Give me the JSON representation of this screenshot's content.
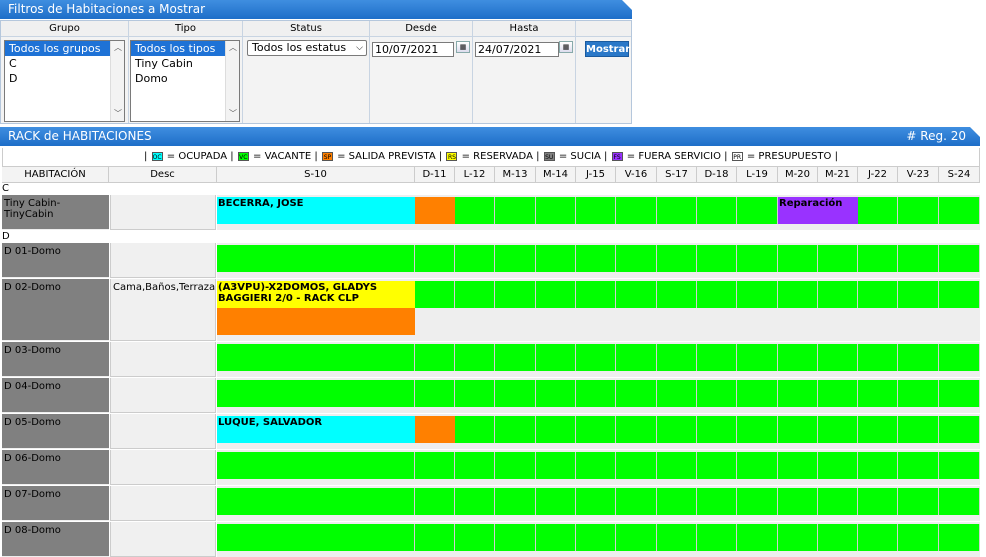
{
  "filters": {
    "title": "Filtros de Habitaciones a Mostrar",
    "labels": {
      "grupo": "Grupo",
      "tipo": "Tipo",
      "status": "Status",
      "desde": "Desde",
      "hasta": "Hasta"
    },
    "grupo_options": [
      "Todos los grupos",
      "C",
      "D"
    ],
    "tipo_options": [
      "Todos los tipos",
      "Tiny Cabin",
      "Domo"
    ],
    "status_value": "Todos los estatus",
    "desde": "10/07/2021",
    "hasta": "24/07/2021",
    "mostrar": "Mostrar"
  },
  "rack": {
    "title": "RACK de HABITACIONES",
    "reg": "# Reg. 20",
    "legend": {
      "ocupada": {
        "code": "OC",
        "label": "= OCUPADA",
        "color": "#00ffff"
      },
      "vacante": {
        "code": "VC",
        "label": "= VACANTE",
        "color": "#00ff00"
      },
      "salida": {
        "code": "SP",
        "label": "= SALIDA PREVISTA",
        "color": "#ff8000"
      },
      "reservada": {
        "code": "RS",
        "label": "= RESERVADA",
        "color": "#ffff00"
      },
      "sucia": {
        "code": "SU",
        "label": "= SUCIA",
        "color": "#808080"
      },
      "fuera": {
        "code": "FS",
        "label": "= FUERA SERVICIO",
        "color": "#9932ff"
      },
      "presupuesto": {
        "code": "PR",
        "label": "= PRESUPUESTO",
        "color": "#ffffff"
      }
    },
    "headers": {
      "habitacion": "HABITACIÓN",
      "desc": "Desc"
    },
    "days": [
      "S-10",
      "D-11",
      "L-12",
      "M-13",
      "M-14",
      "J-15",
      "V-16",
      "S-17",
      "D-18",
      "L-19",
      "M-20",
      "M-21",
      "J-22",
      "V-23",
      "S-24"
    ],
    "groups": [
      {
        "name": "C",
        "rooms": [
          {
            "name": "Tiny Cabin-TinyCabin",
            "desc": "",
            "bars": [
              {
                "text": "BECERRA, JOSE",
                "color": "#00ffff",
                "start": 0,
                "end": 1
              },
              {
                "text": "",
                "color": "#ff8000",
                "start": 1,
                "end": 2
              },
              {
                "text": "Reparación",
                "color": "#9932ff",
                "start": 10,
                "end": 12
              }
            ]
          }
        ]
      },
      {
        "name": "D",
        "rooms": [
          {
            "name": "D 01-Domo",
            "desc": "",
            "bars": []
          },
          {
            "name": "D 02-Domo",
            "desc": "Cama,Baños,Terraza",
            "bars": [
              {
                "text": "(A3VPU)-X2DOMOS, GLADYS BAGGIERI 2/0 - RACK CLP",
                "color": "#ffff00",
                "start": 0,
                "end": 1
              },
              {
                "text": "",
                "color": "#ff8000",
                "start": 0,
                "end": 1,
                "lane": 2
              }
            ]
          },
          {
            "name": "D 03-Domo",
            "desc": "",
            "bars": []
          },
          {
            "name": "D 04-Domo",
            "desc": "",
            "bars": []
          },
          {
            "name": "D 05-Domo",
            "desc": "",
            "bars": [
              {
                "text": "LUQUE, SALVADOR",
                "color": "#00ffff",
                "start": 0,
                "end": 1
              },
              {
                "text": "",
                "color": "#ff8000",
                "start": 1,
                "end": 2
              }
            ]
          },
          {
            "name": "D 06-Domo",
            "desc": "",
            "bars": []
          },
          {
            "name": "D 07-Domo",
            "desc": "",
            "bars": []
          },
          {
            "name": "D 08-Domo",
            "desc": "",
            "bars": []
          }
        ]
      }
    ]
  }
}
